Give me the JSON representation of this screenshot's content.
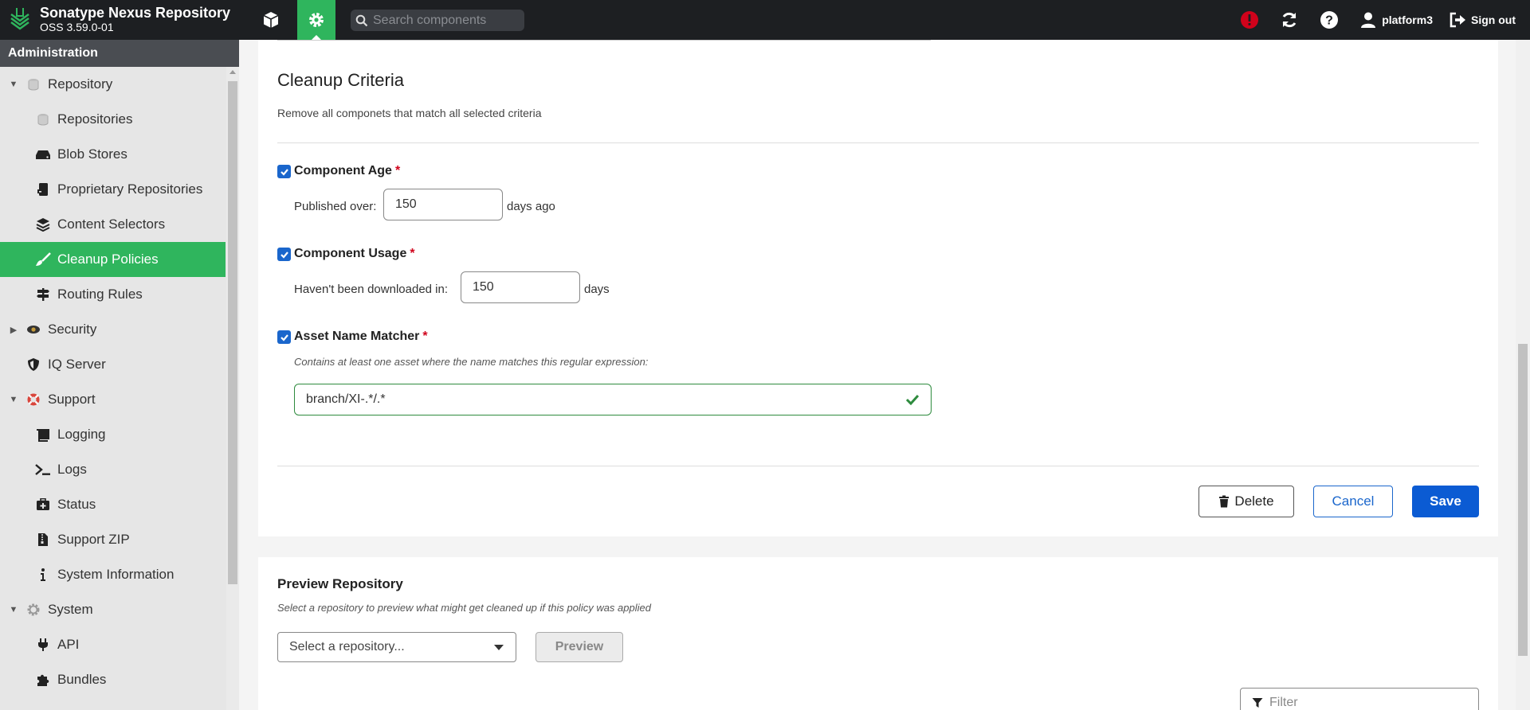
{
  "app": {
    "title": "Sonatype Nexus Repository",
    "version": "OSS 3.59.0-01",
    "search_placeholder": "Search components"
  },
  "topbar": {
    "user": "platform3",
    "signout": "Sign out",
    "alert_color": "#d0021b"
  },
  "sidebar": {
    "header": "Administration",
    "items": [
      {
        "label": "Repository",
        "icon": "database-icon",
        "level": 0,
        "arrow": "down"
      },
      {
        "label": "Repositories",
        "icon": "database-icon",
        "level": 1
      },
      {
        "label": "Blob Stores",
        "icon": "hdd-icon",
        "level": 1
      },
      {
        "label": "Proprietary Repositories",
        "icon": "id-badge-icon",
        "level": 1
      },
      {
        "label": "Content Selectors",
        "icon": "layers-icon",
        "level": 1
      },
      {
        "label": "Cleanup Policies",
        "icon": "brush-icon",
        "level": 1,
        "active": true
      },
      {
        "label": "Routing Rules",
        "icon": "signpost-icon",
        "level": 1
      },
      {
        "label": "Security",
        "icon": "eye-icon",
        "level": 0,
        "arrow": "right"
      },
      {
        "label": "IQ Server",
        "icon": "shield-icon",
        "level": 0
      },
      {
        "label": "Support",
        "icon": "lifebuoy-icon",
        "level": 0,
        "arrow": "down"
      },
      {
        "label": "Logging",
        "icon": "book-icon",
        "level": 1
      },
      {
        "label": "Logs",
        "icon": "terminal-icon",
        "level": 1
      },
      {
        "label": "Status",
        "icon": "medkit-icon",
        "level": 1
      },
      {
        "label": "Support ZIP",
        "icon": "file-zip-icon",
        "level": 1
      },
      {
        "label": "System Information",
        "icon": "info-icon",
        "level": 1
      },
      {
        "label": "System",
        "icon": "gear-icon",
        "level": 0,
        "arrow": "down"
      },
      {
        "label": "API",
        "icon": "plug-icon",
        "level": 1
      },
      {
        "label": "Bundles",
        "icon": "puzzle-icon",
        "level": 1
      }
    ]
  },
  "cleanup": {
    "title": "Cleanup Criteria",
    "description": "Remove all componets that match all selected criteria",
    "age": {
      "label": "Component Age",
      "required": "*",
      "field_label": "Published over:",
      "value": "150",
      "suffix": "days ago"
    },
    "usage": {
      "label": "Component Usage",
      "required": "*",
      "field_label": "Haven't been downloaded in:",
      "value": "150",
      "suffix": "days"
    },
    "asset": {
      "label": "Asset Name Matcher",
      "required": "*",
      "hint": "Contains at least one asset where the name matches this regular expression:",
      "value": "branch/XI-.*/.*"
    },
    "buttons": {
      "delete": "Delete",
      "cancel": "Cancel",
      "save": "Save"
    }
  },
  "preview": {
    "title": "Preview Repository",
    "description": "Select a repository to preview what might get cleaned up if this policy was applied",
    "select_placeholder": "Select a repository...",
    "preview_button": "Preview",
    "filter_placeholder": "Filter"
  },
  "colors": {
    "accent": "#2fb55d",
    "primary": "#0b5bd3",
    "topbar": "#1d1f22"
  }
}
